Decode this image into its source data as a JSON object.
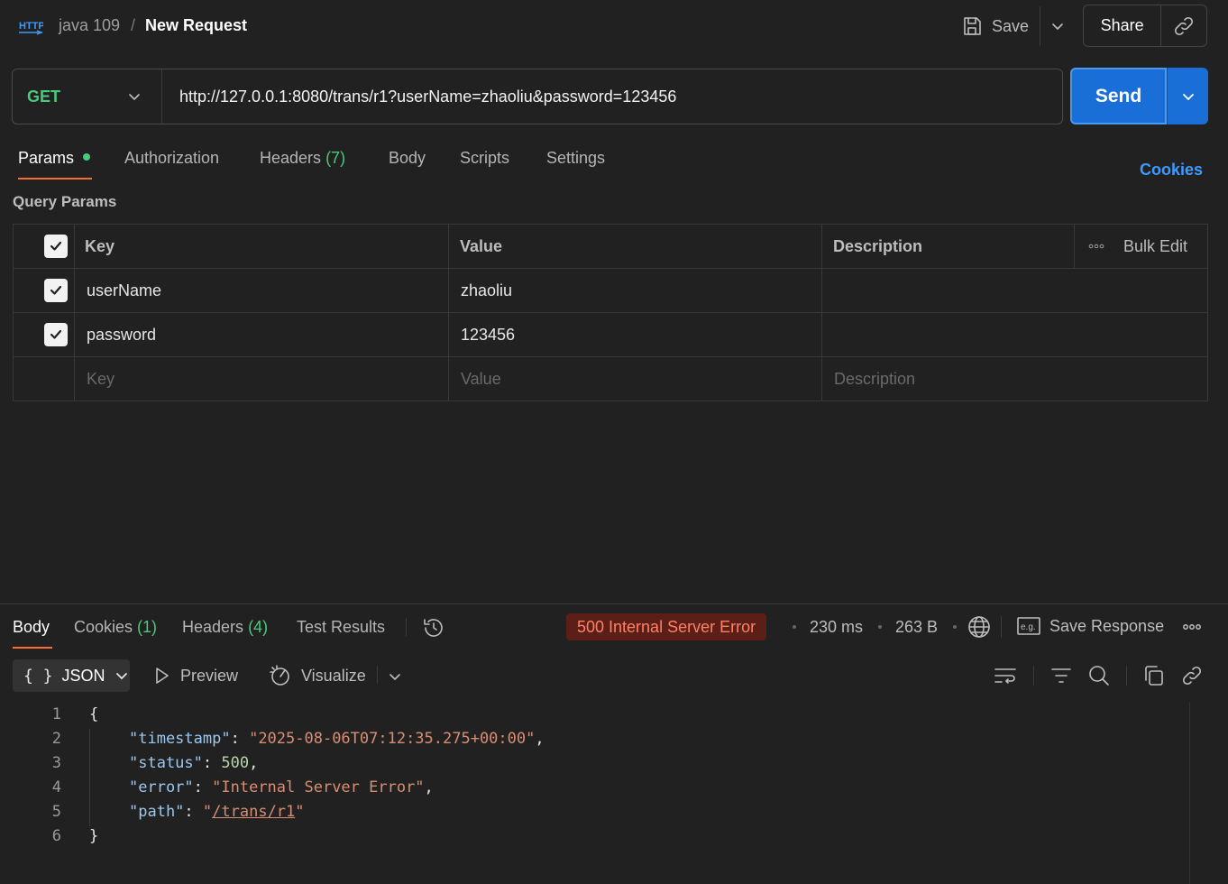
{
  "header": {
    "collection": "java 109",
    "separator": "/",
    "request_name": "New Request",
    "save_label": "Save",
    "share_label": "Share"
  },
  "request": {
    "method": "GET",
    "url": "http://127.0.0.1:8080/trans/r1?userName=zhaoliu&password=123456",
    "send_label": "Send"
  },
  "tabs": {
    "params": "Params",
    "authorization": "Authorization",
    "headers": "Headers",
    "headers_count": "(7)",
    "body": "Body",
    "scripts": "Scripts",
    "settings": "Settings",
    "cookies": "Cookies"
  },
  "query_params": {
    "title": "Query Params",
    "columns": {
      "key": "Key",
      "value": "Value",
      "description": "Description",
      "bulk_edit": "Bulk Edit"
    },
    "rows": [
      {
        "key": "userName",
        "value": "zhaoliu",
        "checked": true
      },
      {
        "key": "password",
        "value": "123456",
        "checked": true
      }
    ],
    "placeholders": {
      "key": "Key",
      "value": "Value",
      "description": "Description"
    }
  },
  "response": {
    "tabs": {
      "body": "Body",
      "cookies": "Cookies",
      "cookies_count": "(1)",
      "headers": "Headers",
      "headers_count": "(4)",
      "test_results": "Test Results"
    },
    "status": "500 Internal Server Error",
    "time": "230 ms",
    "size": "263 B",
    "save_response": "Save Response",
    "format": "JSON",
    "format_braces": "{ }",
    "preview": "Preview",
    "visualize": "Visualize",
    "line_numbers": [
      "1",
      "2",
      "3",
      "4",
      "5",
      "6"
    ],
    "json": {
      "open": "{",
      "close": "}",
      "timestamp_key": "\"timestamp\"",
      "timestamp_value": "\"2025-08-06T07:12:35.275+00:00\"",
      "status_key": "\"status\"",
      "status_value": "500",
      "error_key": "\"error\"",
      "error_value": "\"Internal Server Error\"",
      "path_key": "\"path\"",
      "path_value": "/trans/r1"
    }
  },
  "colors": {
    "accent": "#ff6c37",
    "send": "#1a6ed8",
    "method_get": "#4bc97b",
    "error_badge_bg": "#5c1f17",
    "error_badge_text": "#ff8066",
    "link": "#3d9bff"
  }
}
